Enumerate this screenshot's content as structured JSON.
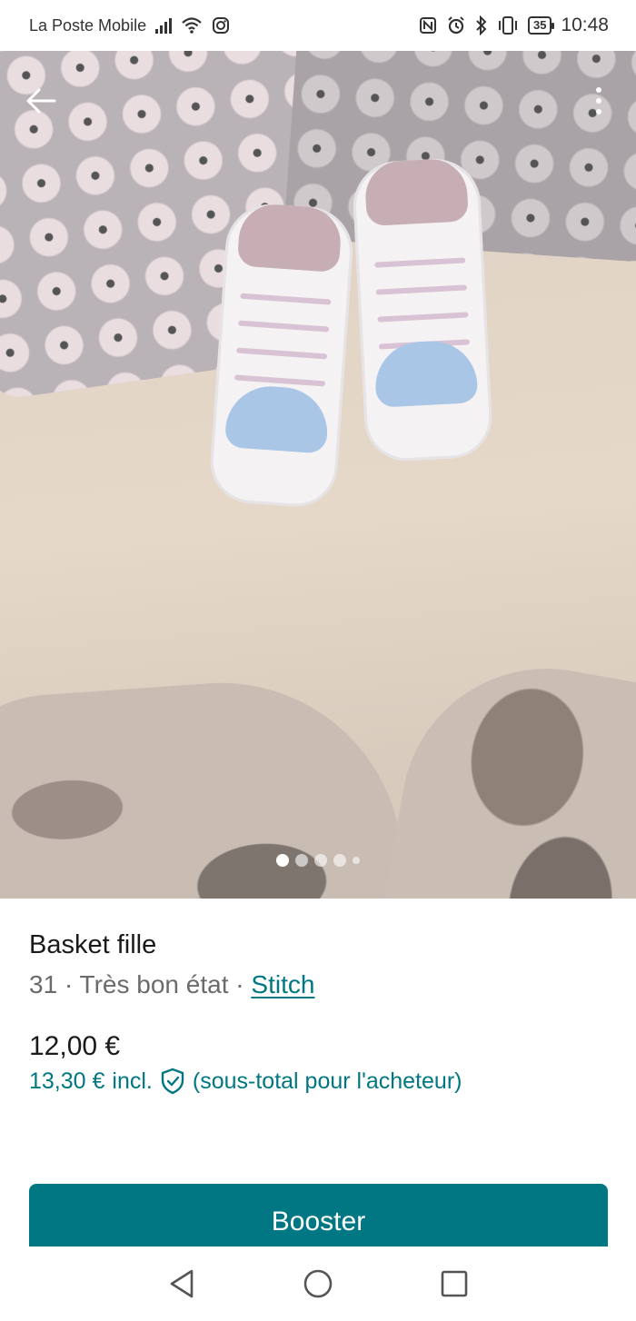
{
  "status_bar": {
    "carrier": "La Poste Mobile",
    "battery": "35",
    "time": "10:48",
    "icons": [
      "signal-icon",
      "wifi-icon",
      "instagram-icon",
      "nfc-icon",
      "alarm-icon",
      "bluetooth-icon",
      "vibrate-icon",
      "battery-icon"
    ]
  },
  "gallery": {
    "photo_count": 5,
    "active_index": 0,
    "back_icon": "arrow-left-icon",
    "menu_icon": "more-vert-icon"
  },
  "item": {
    "title": "Basket fille",
    "size": "31",
    "separator_1": " · ",
    "condition": "Très bon état",
    "separator_2": " · ",
    "brand": "Stitch",
    "price": "12,00 €",
    "price_incl_amount": "13,30 €",
    "price_incl_word": "incl.",
    "price_incl_note": "(sous-total pour l'acheteur)",
    "protection_icon": "shield-check-icon"
  },
  "actions": {
    "booster_label": "Booster"
  },
  "colors": {
    "accent": "#007782",
    "text_primary": "#1a1a1a",
    "text_secondary": "#6b6b6b"
  },
  "nav_bar": {
    "icons": [
      "back-triangle-icon",
      "home-circle-icon",
      "recents-square-icon"
    ]
  }
}
